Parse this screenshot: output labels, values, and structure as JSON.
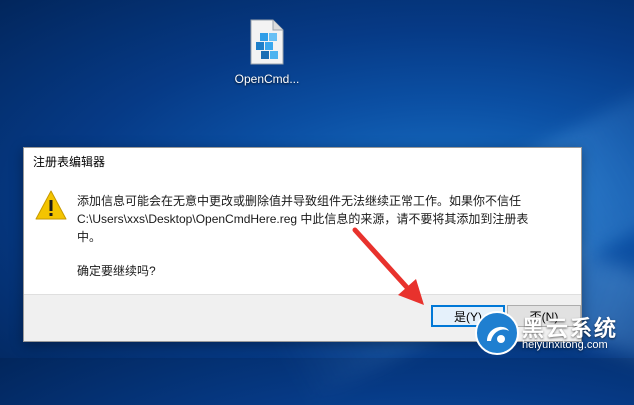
{
  "desktop": {
    "file_icon": {
      "label": "OpenCmd...",
      "icon": "registry-file-icon"
    }
  },
  "dialog": {
    "title": "注册表编辑器",
    "icon": "warning-icon",
    "message_lines": [
      "添加信息可能会在无意中更改或删除值并导致组件无法继续正常工作。如果你不信任",
      "C:\\Users\\xxs\\Desktop\\OpenCmdHere.reg 中此信息的来源，请不要将其添加到注册表",
      "中。"
    ],
    "confirm": "确定要继续吗?",
    "buttons": {
      "yes": "是(Y)",
      "no": "否(N)"
    }
  },
  "annotation": {
    "icon": "red-arrow-icon",
    "color": "#e8322d"
  },
  "watermark": {
    "brand": "黑云系统",
    "url": "heiyunxitong.com",
    "icon": "logo-badge-icon"
  },
  "colors": {
    "accent": "#0078d7",
    "desktop_bg": "#0b4fa3",
    "warning": "#f4c400"
  }
}
